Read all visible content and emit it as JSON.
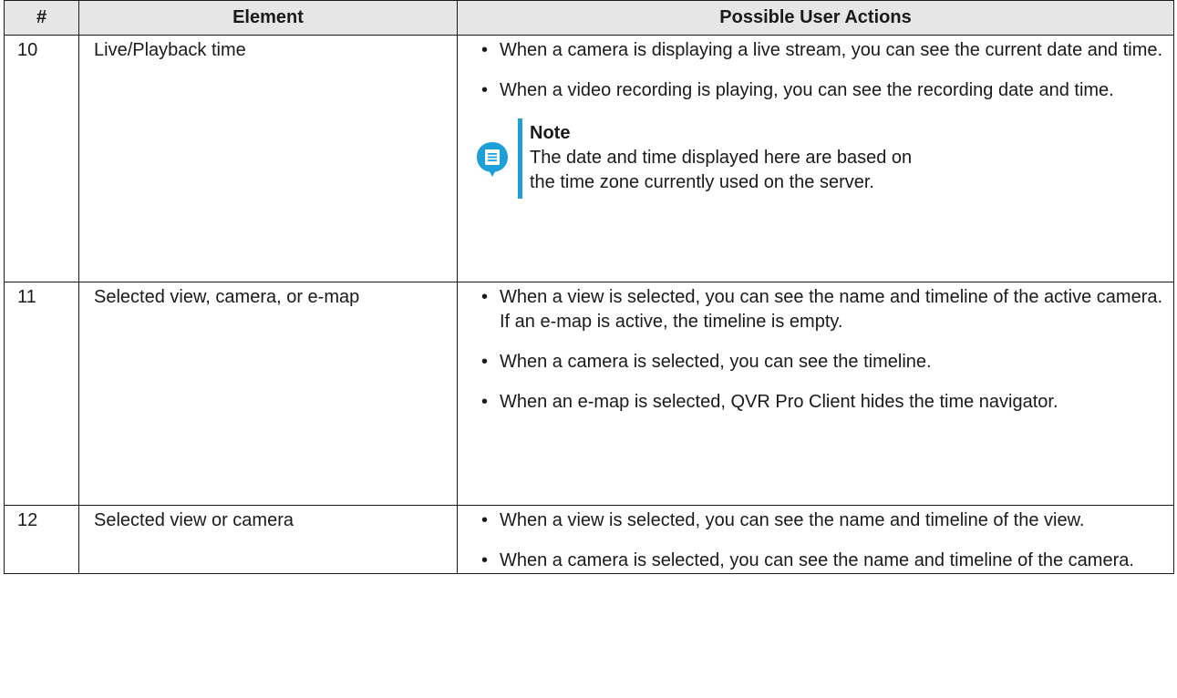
{
  "table": {
    "headers": [
      "#",
      "Element",
      "Possible User Actions"
    ],
    "rows": [
      {
        "num": "10",
        "element": "Live/Playback time",
        "actions": [
          "When a camera is displaying a live stream, you can see the current date and time.",
          "When a video recording is playing, you can see the recording date and time."
        ],
        "note": {
          "icon": "note-speech-bubble-icon",
          "title": "Note",
          "text": "The date and time displayed here are based on the time zone currently used on the server."
        }
      },
      {
        "num": "11",
        "element": "Selected view, camera, or e-map",
        "actions": [
          "When a view is selected, you can see the name and timeline of the active camera. If an e-map is active, the timeline is empty.",
          "When a camera is selected, you can see the timeline.",
          "When an e-map is selected, QVR Pro Client hides the time navigator."
        ]
      },
      {
        "num": "12",
        "element": "Selected view or camera",
        "actions": [
          "When a view is selected, you can see the name and timeline of the view.",
          "When a camera is selected, you can see the name and timeline of the camera."
        ]
      }
    ],
    "bullet_char": "•"
  },
  "colors": {
    "header_bg": "#e6e6e6",
    "note_accent": "#1e9fd8",
    "border": "#1a1a1a"
  }
}
